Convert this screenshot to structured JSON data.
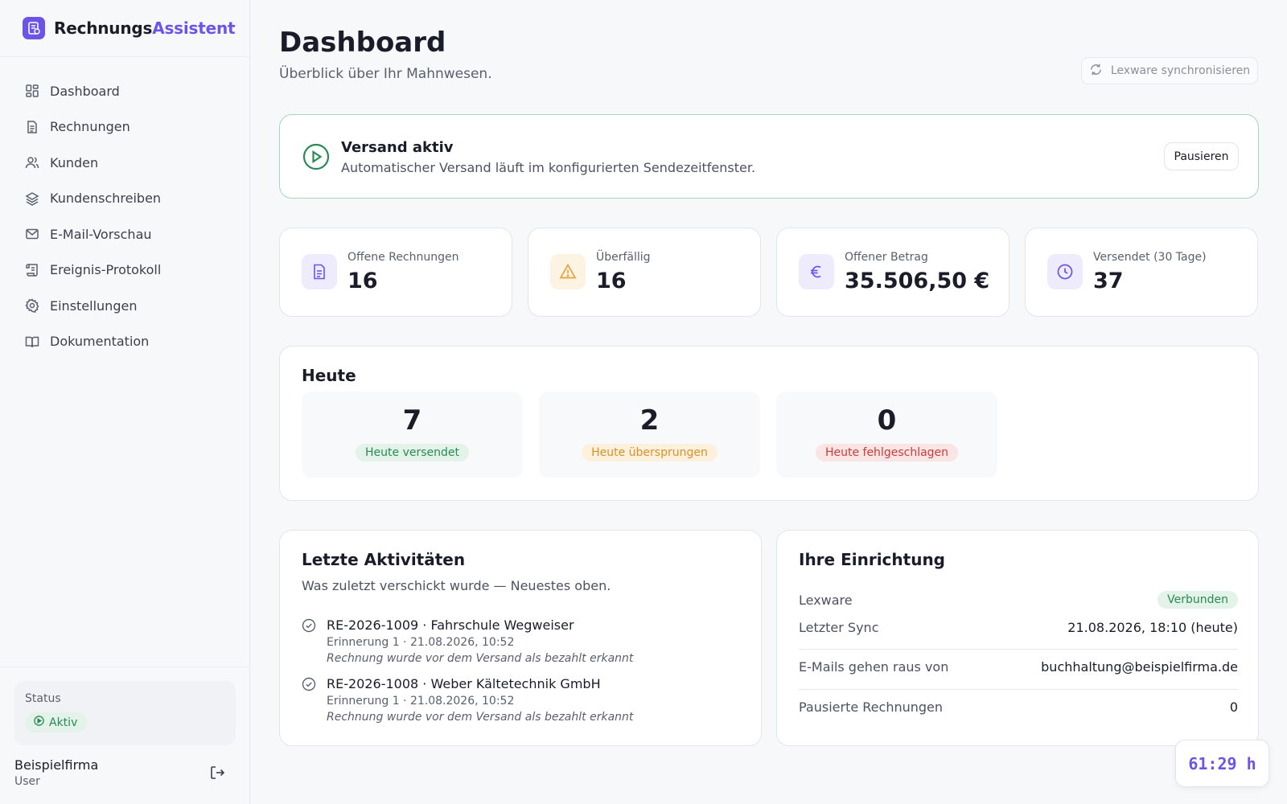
{
  "brand": {
    "name_part1": "Rechnungs",
    "name_part2": "Assistent"
  },
  "colors": {
    "accent": "#6d54e8",
    "success": "#2a8a52",
    "warning": "#e6a23c",
    "danger": "#d64545"
  },
  "sidebar": {
    "items": [
      {
        "label": "Dashboard",
        "icon": "dashboard-grid-icon"
      },
      {
        "label": "Rechnungen",
        "icon": "document-icon"
      },
      {
        "label": "Kunden",
        "icon": "users-icon"
      },
      {
        "label": "Kundenschreiben",
        "icon": "layers-icon"
      },
      {
        "label": "E-Mail-Vorschau",
        "icon": "mail-icon"
      },
      {
        "label": "Ereignis-Protokoll",
        "icon": "scroll-icon"
      },
      {
        "label": "Einstellungen",
        "icon": "gear-icon"
      },
      {
        "label": "Dokumentation",
        "icon": "book-icon"
      }
    ],
    "status_label": "Status",
    "status_value": "Aktiv",
    "user_name": "Beispielfirma",
    "user_role": "User"
  },
  "header": {
    "title": "Dashboard",
    "subtitle": "Überblick über Ihr Mahnwesen.",
    "sync_label": "Lexware synchronisieren"
  },
  "banner": {
    "title": "Versand aktiv",
    "subtitle": "Automatischer Versand läuft im konfigurierten Sendezeitfenster.",
    "button": "Pausieren"
  },
  "stats": [
    {
      "label": "Offene Rechnungen",
      "value": "16",
      "icon": "document-icon"
    },
    {
      "label": "Überfällig",
      "value": "16",
      "icon": "warning-icon"
    },
    {
      "label": "Offener Betrag",
      "value": "35.506,50 €",
      "icon": "euro-icon"
    },
    {
      "label": "Versendet (30 Tage)",
      "value": "37",
      "icon": "clock-icon"
    }
  ],
  "today": {
    "title": "Heute",
    "cells": [
      {
        "value": "7",
        "label": "Heute versendet"
      },
      {
        "value": "2",
        "label": "Heute übersprungen"
      },
      {
        "value": "0",
        "label": "Heute fehlgeschlagen"
      }
    ]
  },
  "activity": {
    "title": "Letzte Aktivitäten",
    "subtitle": "Was zuletzt verschickt wurde — Neuestes oben.",
    "items": [
      {
        "title": "RE-2026-1009 · Fahrschule Wegweiser",
        "meta": "Erinnerung 1 · 21.08.2026, 10:52",
        "note": "Rechnung wurde vor dem Versand als bezahlt erkannt"
      },
      {
        "title": "RE-2026-1008 · Weber Kältetechnik GmbH",
        "meta": "Erinnerung 1 · 21.08.2026, 10:52",
        "note": "Rechnung wurde vor dem Versand als bezahlt erkannt"
      }
    ]
  },
  "setup": {
    "title": "Ihre Einrichtung",
    "rows": [
      {
        "key": "Lexware",
        "value": "Verbunden"
      },
      {
        "key": "Letzter Sync",
        "value": "21.08.2026, 18:10 (heute)"
      },
      {
        "key": "E-Mails gehen raus von",
        "value": "buchhaltung@beispielfirma.de"
      },
      {
        "key": "Pausierte Rechnungen",
        "value": "0"
      }
    ]
  },
  "timer": "61:29 h"
}
